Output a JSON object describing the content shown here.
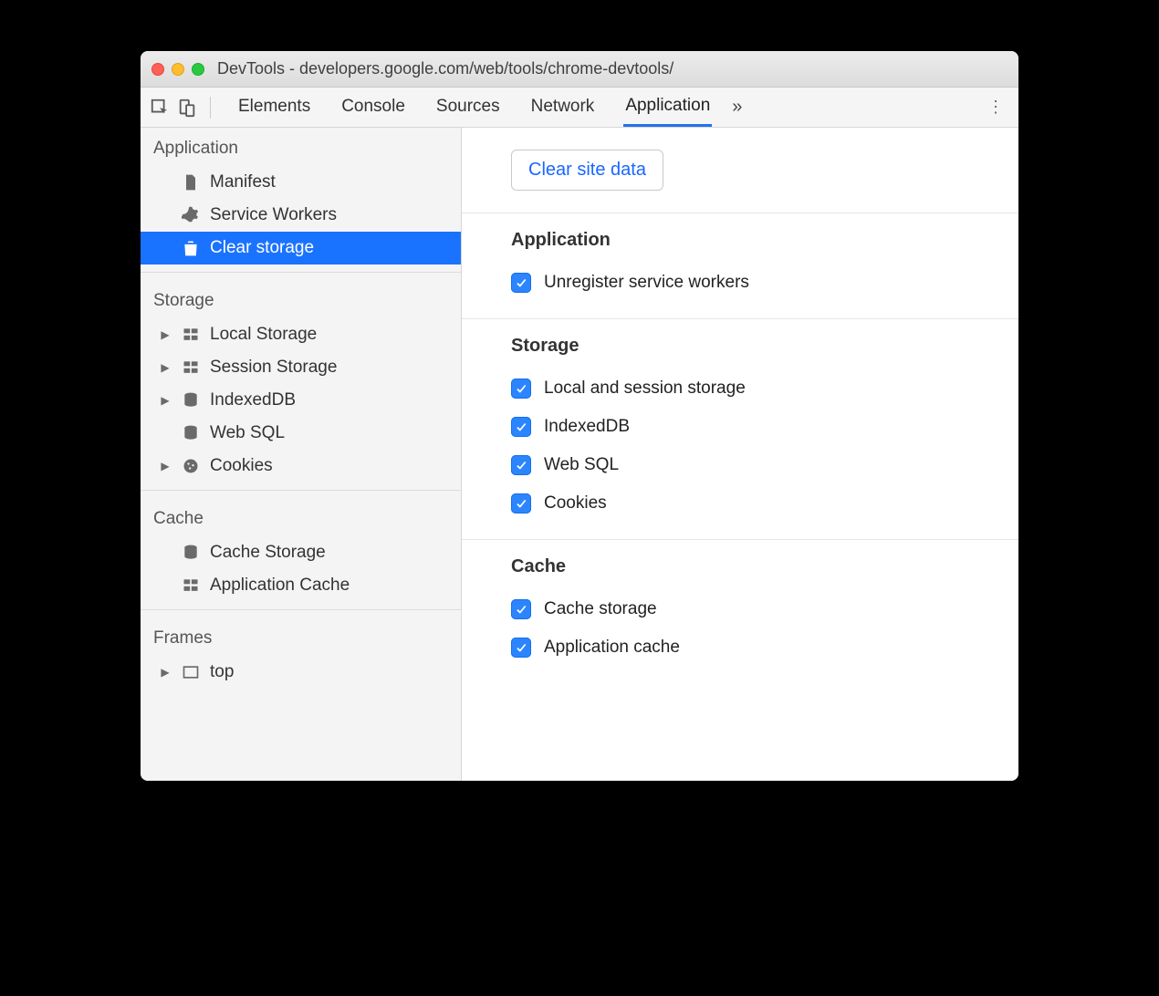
{
  "window": {
    "title": "DevTools - developers.google.com/web/tools/chrome-devtools/"
  },
  "toolbar": {
    "tabs": [
      "Elements",
      "Console",
      "Sources",
      "Network",
      "Application"
    ],
    "active_tab_index": 4
  },
  "sidebar": {
    "groups": [
      {
        "title": "Application",
        "items": [
          {
            "label": "Manifest",
            "icon": "document-icon",
            "expandable": false
          },
          {
            "label": "Service Workers",
            "icon": "gear-icon",
            "expandable": false
          },
          {
            "label": "Clear storage",
            "icon": "trash-icon",
            "expandable": false,
            "selected": true
          }
        ]
      },
      {
        "title": "Storage",
        "items": [
          {
            "label": "Local Storage",
            "icon": "grid-icon",
            "expandable": true
          },
          {
            "label": "Session Storage",
            "icon": "grid-icon",
            "expandable": true
          },
          {
            "label": "IndexedDB",
            "icon": "database-icon",
            "expandable": true
          },
          {
            "label": "Web SQL",
            "icon": "database-icon",
            "expandable": false
          },
          {
            "label": "Cookies",
            "icon": "cookie-icon",
            "expandable": true
          }
        ]
      },
      {
        "title": "Cache",
        "items": [
          {
            "label": "Cache Storage",
            "icon": "database-icon",
            "expandable": false
          },
          {
            "label": "Application Cache",
            "icon": "grid-icon",
            "expandable": false
          }
        ]
      },
      {
        "title": "Frames",
        "items": [
          {
            "label": "top",
            "icon": "frame-icon",
            "expandable": true
          }
        ]
      }
    ]
  },
  "main": {
    "clear_button": "Clear site data",
    "sections": [
      {
        "title": "Application",
        "options": [
          {
            "label": "Unregister service workers",
            "checked": true
          }
        ]
      },
      {
        "title": "Storage",
        "options": [
          {
            "label": "Local and session storage",
            "checked": true
          },
          {
            "label": "IndexedDB",
            "checked": true
          },
          {
            "label": "Web SQL",
            "checked": true
          },
          {
            "label": "Cookies",
            "checked": true
          }
        ]
      },
      {
        "title": "Cache",
        "options": [
          {
            "label": "Cache storage",
            "checked": true
          },
          {
            "label": "Application cache",
            "checked": true
          }
        ]
      }
    ]
  }
}
